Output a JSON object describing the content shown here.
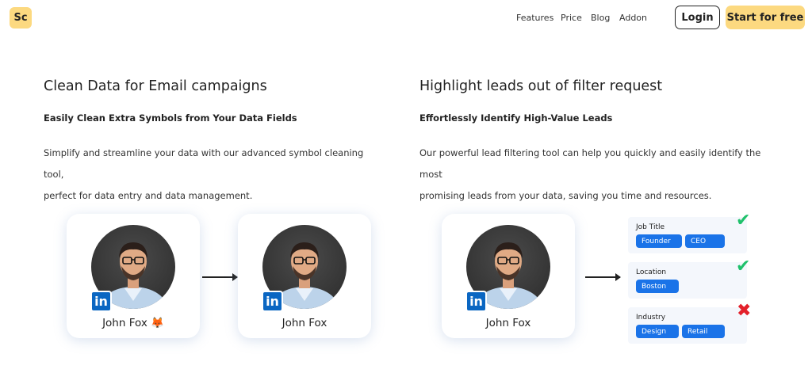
{
  "header": {
    "logo_text": "Sc",
    "nav": [
      "Features",
      "Price",
      "Blog",
      "Addon"
    ],
    "login_label": "Login",
    "start_label": "Start for free"
  },
  "left_section": {
    "title": "Clean Data for Email campaigns",
    "subtitle": "Easily Clean Extra Symbols from Your Data Fields",
    "paragraph_line1": "Simplify and streamline your data with our advanced symbol cleaning tool,",
    "paragraph_line2": "perfect for data entry and data management.",
    "card_before_name": "John Fox 🦊",
    "card_after_name": "John Fox"
  },
  "right_section": {
    "title": "Highlight leads out of filter request",
    "subtitle": "Effortlessly Identify High-Value Leads",
    "paragraph_line1": "Our powerful lead filtering tool can help you quickly and easily identify the most",
    "paragraph_line2": "promising leads from your data, saving you time and resources.",
    "card_name": "John Fox",
    "filters": [
      {
        "label": "Job Title",
        "tags": [
          "Founder",
          "CEO"
        ],
        "status": "match"
      },
      {
        "label": "Location",
        "tags": [
          "Boston"
        ],
        "status": "match"
      },
      {
        "label": "Industry",
        "tags": [
          "Design",
          "Retail"
        ],
        "status": "no-match"
      }
    ]
  },
  "icons": {
    "linkedin_glyph": "in",
    "check_glyph": "✔",
    "cross_glyph": "✖"
  },
  "colors": {
    "accent": "#fcd980",
    "linkedin": "#0a66c2",
    "tag_blue": "#1a73e8",
    "check_green": "#1fc16b",
    "cross_red": "#e3202a"
  }
}
